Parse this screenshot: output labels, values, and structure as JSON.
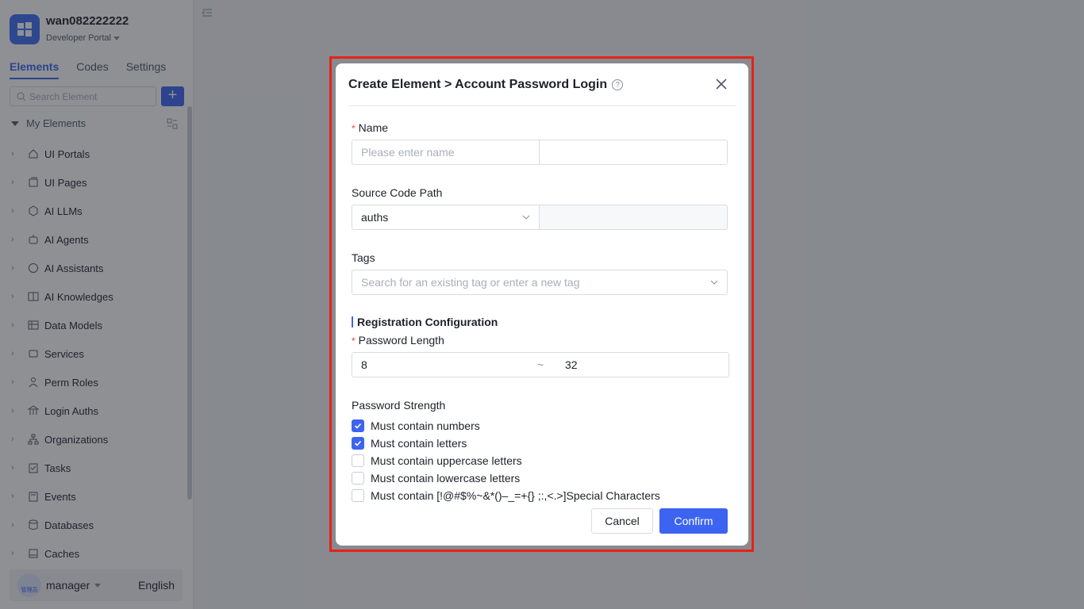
{
  "app": {
    "name": "wan082222222",
    "portal": "Developer Portal"
  },
  "tabs": [
    "Elements",
    "Codes",
    "Settings"
  ],
  "search": {
    "placeholder": "Search Element"
  },
  "tree": {
    "root_label": "My Elements",
    "items": [
      {
        "label": "UI Portals",
        "icon": "home-icon"
      },
      {
        "label": "UI Pages",
        "icon": "pages-icon"
      },
      {
        "label": "AI LLMs",
        "icon": "llm-icon"
      },
      {
        "label": "AI Agents",
        "icon": "robot-icon"
      },
      {
        "label": "AI Assistants",
        "icon": "assistant-icon"
      },
      {
        "label": "AI Knowledges",
        "icon": "book-icon"
      },
      {
        "label": "Data Models",
        "icon": "table-icon"
      },
      {
        "label": "Services",
        "icon": "service-icon"
      },
      {
        "label": "Perm Roles",
        "icon": "role-icon"
      },
      {
        "label": "Login Auths",
        "icon": "bank-icon"
      },
      {
        "label": "Organizations",
        "icon": "org-icon"
      },
      {
        "label": "Tasks",
        "icon": "task-icon"
      },
      {
        "label": "Events",
        "icon": "event-icon"
      },
      {
        "label": "Databases",
        "icon": "database-icon"
      },
      {
        "label": "Caches",
        "icon": "cache-icon"
      }
    ]
  },
  "user": {
    "name": "manager",
    "avatar_text": "管理员",
    "language": "English"
  },
  "modal": {
    "title": "Create Element > Account Password Login",
    "name_label": "Name",
    "name_placeholder": "Please enter name",
    "source_label": "Source Code Path",
    "source_value": "auths",
    "tags_label": "Tags",
    "tags_placeholder": "Search for an existing tag or enter a new tag",
    "section_title": "Registration Configuration",
    "password_length_label": "Password Length",
    "min_length": "8",
    "range_sep": "~",
    "max_length": "32",
    "strength_label": "Password Strength",
    "checks": [
      {
        "label": "Must contain numbers",
        "checked": true
      },
      {
        "label": "Must contain letters",
        "checked": true
      },
      {
        "label": "Must contain uppercase letters",
        "checked": false
      },
      {
        "label": "Must contain lowercase letters",
        "checked": false
      },
      {
        "label": "Must contain [!@#$%~&*()–_=+{} ;:,<.>]Special Characters",
        "checked": false
      }
    ],
    "cancel_label": "Cancel",
    "confirm_label": "Confirm"
  },
  "colors": {
    "accent": "#3c64f0",
    "required": "#f53f3f",
    "highlight": "#e5221b"
  }
}
